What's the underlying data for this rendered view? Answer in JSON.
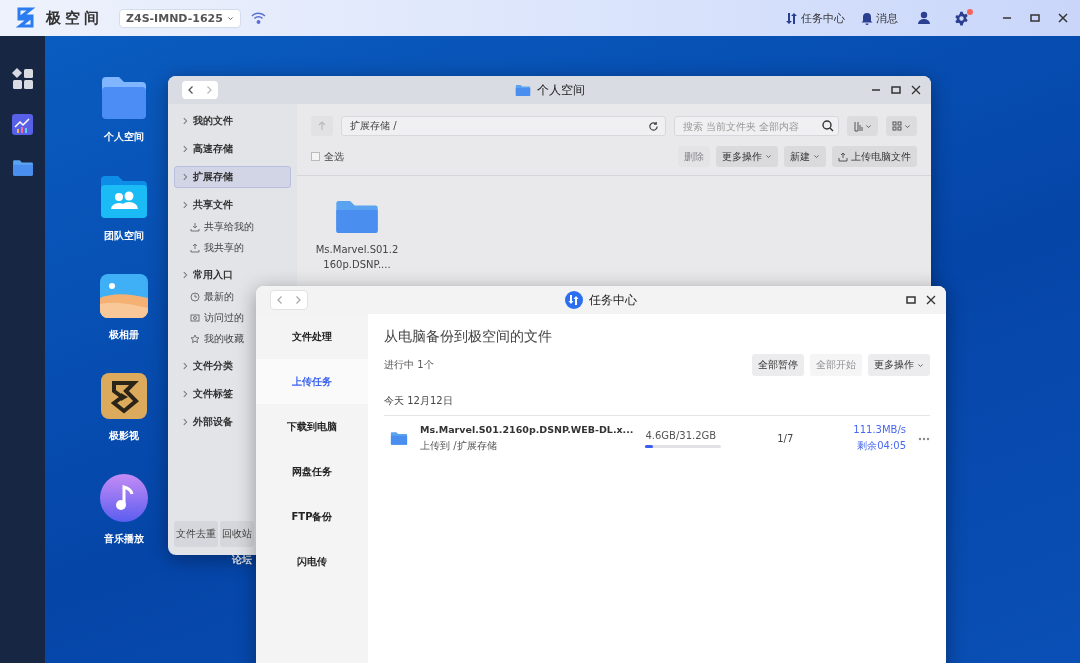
{
  "top_bar": {
    "logo_text": "极空间",
    "device": "Z4S-IMND-1625",
    "task_center": "任务中心",
    "messages": "消息",
    "settings_alert": true
  },
  "desktop_apps": [
    {
      "label": "个人空间",
      "kind": "folder"
    },
    {
      "label": "团队空间",
      "kind": "team"
    },
    {
      "label": "极相册",
      "kind": "photos"
    },
    {
      "label": "极影视",
      "kind": "video"
    },
    {
      "label": "音乐播放",
      "kind": "music"
    }
  ],
  "desktop_partial_label": "论坛",
  "file_window": {
    "title": "个人空间",
    "sidebar": [
      {
        "label": "我的文件",
        "selected": false
      },
      {
        "label": "高速存储",
        "selected": false
      },
      {
        "label": "扩展存储",
        "selected": true
      },
      {
        "label": "共享文件",
        "selected": false,
        "children": [
          {
            "label": "共享给我的",
            "kind": "download"
          },
          {
            "label": "我共享的",
            "kind": "upload"
          }
        ]
      },
      {
        "label": "常用入口",
        "selected": false,
        "children": [
          {
            "label": "最新的",
            "kind": "clock"
          },
          {
            "label": "访问过的",
            "kind": "eye"
          },
          {
            "label": "我的收藏",
            "kind": "star"
          }
        ]
      },
      {
        "label": "文件分类",
        "selected": false
      },
      {
        "label": "文件标签",
        "selected": false
      },
      {
        "label": "外部设备",
        "selected": false
      }
    ],
    "bottom_buttons": [
      "文件去重",
      "回收站"
    ],
    "path": "扩展存储 /",
    "search": {
      "placeholder": "搜索 当前文件夹 全部内容"
    },
    "select_all": {
      "label": "全选",
      "checked": false
    },
    "actions": [
      {
        "label": "删除",
        "disabled": true,
        "kind": "plain"
      },
      {
        "label": "更多操作",
        "disabled": false,
        "kind": "dropdown"
      },
      {
        "label": "新建",
        "disabled": false,
        "kind": "dropdown"
      },
      {
        "label": "上传电脑文件",
        "disabled": false,
        "kind": "upload"
      }
    ],
    "files": [
      {
        "name": "Ms.Marvel.S01.2160p.DSNP...."
      }
    ]
  },
  "task_window": {
    "title": "任务中心",
    "nav": [
      {
        "label": "文件处理",
        "selected": false
      },
      {
        "label": "上传任务",
        "selected": true
      },
      {
        "label": "下载到电脑",
        "selected": false
      },
      {
        "label": "网盘任务",
        "selected": false
      },
      {
        "label": "FTP备份",
        "selected": false
      },
      {
        "label": "闪电传",
        "selected": false
      }
    ],
    "heading": "从电脑备份到极空间的文件",
    "status": "进行中 1个",
    "buttons": [
      {
        "label": "全部暂停",
        "disabled": false,
        "kind": "plain"
      },
      {
        "label": "全部开始",
        "disabled": true,
        "kind": "plain"
      },
      {
        "label": "更多操作",
        "disabled": false,
        "kind": "dropdown"
      }
    ],
    "group_date": "今天 12月12日",
    "tasks": [
      {
        "name": "Ms.Marvel.S01.2160p.DSNP.WEB-DL.x...",
        "destination": "上传到 /扩展存储",
        "size": "4.6GB/31.2GB",
        "level": 0.1,
        "count": "1/7",
        "speed": "111.3MB/s",
        "remaining": "剩余04:05"
      }
    ]
  }
}
